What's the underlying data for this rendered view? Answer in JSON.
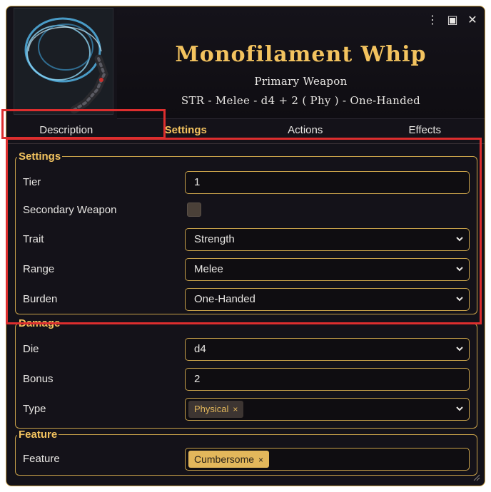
{
  "header": {
    "title": "Monofilament Whip",
    "subtitle": "Primary Weapon",
    "summary": "STR - Melee - d4 + 2 ( Phy ) - One-Handed"
  },
  "window_controls": {
    "menu": "⋮",
    "token": "▣",
    "close": "✕"
  },
  "tabs": [
    {
      "label": "Description",
      "active": false
    },
    {
      "label": "Settings",
      "active": true
    },
    {
      "label": "Actions",
      "active": false
    },
    {
      "label": "Effects",
      "active": false
    }
  ],
  "settings": {
    "legend": "Settings",
    "tier_label": "Tier",
    "tier_value": "1",
    "secondary_label": "Secondary Weapon",
    "secondary_checked": false,
    "trait_label": "Trait",
    "trait_value": "Strength",
    "range_label": "Range",
    "range_value": "Melee",
    "burden_label": "Burden",
    "burden_value": "One-Handed"
  },
  "damage": {
    "legend": "Damage",
    "die_label": "Die",
    "die_value": "d4",
    "bonus_label": "Bonus",
    "bonus_value": "2",
    "type_label": "Type",
    "type_tag": "Physical",
    "tag_remove": "×"
  },
  "feature": {
    "legend": "Feature",
    "feature_label": "Feature",
    "feature_tag": "Cumbersome",
    "tag_remove": "×"
  },
  "colors": {
    "accent": "#f3c35f",
    "border": "#c9a24a",
    "background": "#141219",
    "highlight": "#dd2e2e"
  }
}
